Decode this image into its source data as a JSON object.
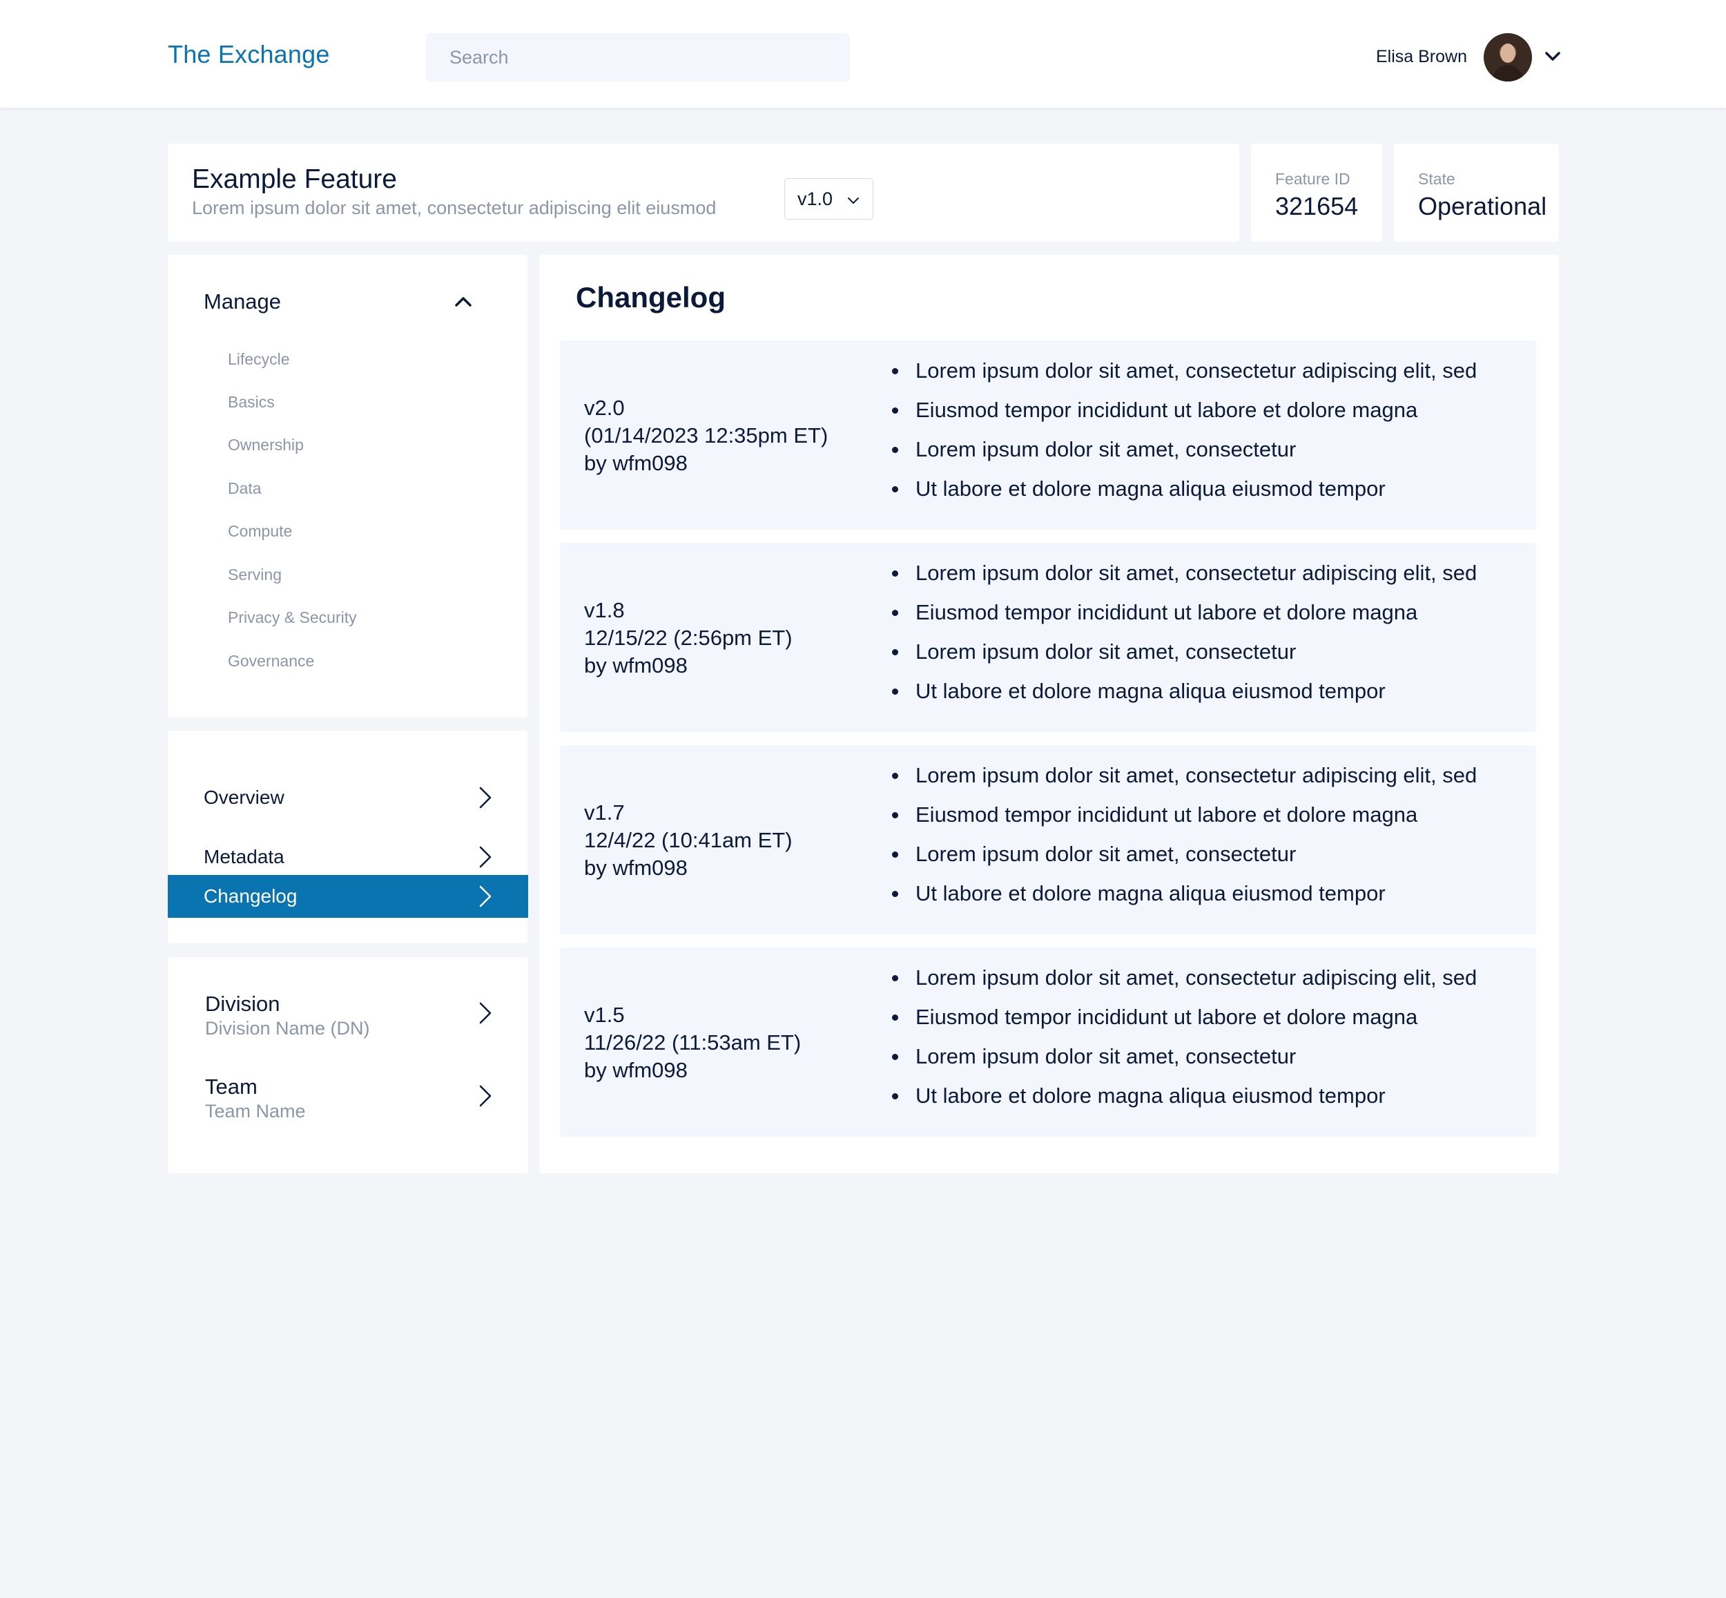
{
  "header": {
    "brand": "The Exchange",
    "search_placeholder": "Search",
    "user_name": "Elisa Brown"
  },
  "feature": {
    "title": "Example Feature",
    "description": "Lorem ipsum dolor sit amet, consectetur adipiscing elit eiusmod",
    "version": "v1.0",
    "id_label": "Feature ID",
    "id_value": "321654",
    "state_label": "State",
    "state_value": "Operational"
  },
  "sidebar": {
    "manage_label": "Manage",
    "manage_items": [
      "Lifecycle",
      "Basics",
      "Ownership",
      "Data",
      "Compute",
      "Serving",
      "Privacy & Security",
      "Governance"
    ],
    "nav_items": [
      {
        "label": "Overview",
        "active": false
      },
      {
        "label": "Metadata",
        "active": false
      },
      {
        "label": "Changelog",
        "active": true
      }
    ],
    "org": [
      {
        "title": "Division",
        "subtitle": "Division Name (DN)"
      },
      {
        "title": "Team",
        "subtitle": "Team Name"
      }
    ]
  },
  "changelog": {
    "title": "Changelog",
    "entries": [
      {
        "version": "v2.0",
        "date": "(01/14/2023 12:35pm ET)",
        "author": "by wfm098",
        "notes": [
          "Lorem ipsum dolor sit amet, consectetur adipiscing elit, sed",
          "Eiusmod tempor incididunt ut labore et dolore magna",
          "Lorem ipsum dolor sit amet, consectetur",
          "Ut labore et dolore magna aliqua eiusmod tempor"
        ]
      },
      {
        "version": "v1.8",
        "date": "12/15/22 (2:56pm ET)",
        "author": "by wfm098",
        "notes": [
          "Lorem ipsum dolor sit amet, consectetur adipiscing elit, sed",
          "Eiusmod tempor incididunt ut labore et dolore magna",
          "Lorem ipsum dolor sit amet, consectetur",
          "Ut labore et dolore magna aliqua eiusmod tempor"
        ]
      },
      {
        "version": "v1.7",
        "date": "12/4/22 (10:41am ET)",
        "author": "by wfm098",
        "notes": [
          "Lorem ipsum dolor sit amet, consectetur adipiscing elit, sed",
          "Eiusmod tempor incididunt ut labore et dolore magna",
          "Lorem ipsum dolor sit amet, consectetur",
          "Ut labore et dolore magna aliqua eiusmod tempor"
        ]
      },
      {
        "version": "v1.5",
        "date": "11/26/22 (11:53am ET)",
        "author": "by wfm098",
        "notes": [
          "Lorem ipsum dolor sit amet, consectetur adipiscing elit, sed",
          "Eiusmod tempor incididunt ut labore et dolore magna",
          "Lorem ipsum dolor sit amet, consectetur",
          "Ut labore et dolore magna aliqua eiusmod tempor"
        ]
      }
    ]
  },
  "colors": {
    "brand": "#0a74b0",
    "background": "#f3f5f8",
    "muted_text": "#8c96a8",
    "entry_bg": "#f3f6fc"
  },
  "icons": {
    "user_menu": "chevron-down-icon",
    "manage_toggle": "chevron-up-icon",
    "nav": "chevron-right-icon",
    "version_select": "chevron-down-icon"
  }
}
